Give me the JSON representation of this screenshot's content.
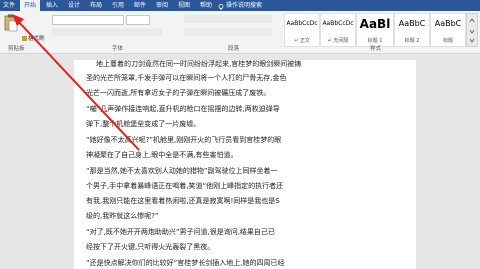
{
  "tabs": [
    "文件",
    "开始",
    "插入",
    "设计",
    "布局",
    "引用",
    "邮件",
    "审阅",
    "视图",
    "帮助"
  ],
  "active_tab": "开始",
  "search": {
    "label": "操作说明搜索"
  },
  "ribbon": {
    "clipboard": {
      "label": "剪贴板"
    },
    "font": {
      "label": "字体"
    },
    "paragraph": {
      "label": "段落"
    },
    "styles": {
      "label": "样式"
    },
    "format_painter": {
      "label": "格式刷"
    },
    "style_items": [
      {
        "sample": "AaBbCcDc",
        "name": "↵ 正文"
      },
      {
        "sample": "AaBbCcDc",
        "name": "↵ 无间隔"
      },
      {
        "sample": "AaBl",
        "name": "标题 1"
      },
      {
        "sample": "AaBbC",
        "name": "标题 2"
      },
      {
        "sample": "AaBbC",
        "name": "标题"
      }
    ]
  },
  "document": {
    "lines": [
      "地上蔓着的刀剑竟然在同一时间纷纷浮起来,官桂梦的眼剑瞬间被铸",
      "圣的光芒所笼罩,千发手弹可以在瞬间将一个人打的尸骨无存,金色",
      "光芒一闪而逝,所有拿近女子的子弹在瞬间被碾压成了废铁。",
      "“嘣”几声弹作接连响起,直升机的枪口在摇摆的边转,两枚迫弹导",
      "弹下,整个机舱堡垒变成了一片废墟。",
      "“她好像不太高兴呢?”机舱里,刚刚开火的飞行员看到官桂梦的眼",
      "神凝聚在了自己身上,眼中全是不满,有些害怕道。",
      "“那是当然,她不太喜欢别人动她的猎物”副驾驶位上同样坐着一",
      "个男子,手中拿着暴峰语正在喝着,笑道“他刚上峰指定的执行者还",
      "有我,我刚只能在这里看着热闹啦,还真是寂寞啊!同样是我也是S",
      "级的,我昨就这么惨呢?”",
      "“对了,既不她开开两炮助助兴”男子问道,很是询问,结果自己已",
      "经按下了开火键,只听得火光轰裂了黑夜。",
      "“还是快点解决你们的比较好”官桂梦长剑插入地上,她的四周已经"
    ]
  }
}
